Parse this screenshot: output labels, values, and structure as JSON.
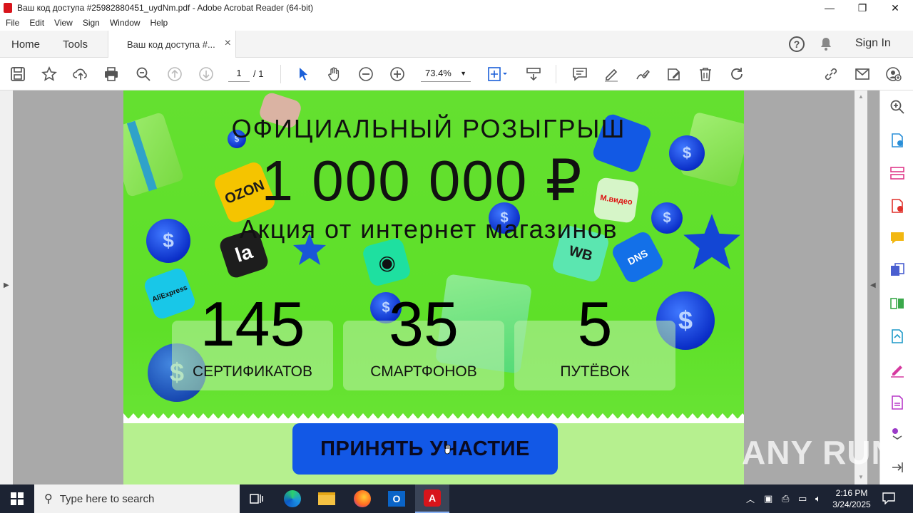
{
  "window": {
    "title": "Ваш код доступа #25982880451_uydNm.pdf - Adobe Acrobat Reader (64-bit)",
    "minimize": "—",
    "maximize": "❐",
    "close": "✕"
  },
  "menu": [
    "File",
    "Edit",
    "View",
    "Sign",
    "Window",
    "Help"
  ],
  "tabs": {
    "home": "Home",
    "tools": "Tools",
    "document": "Ваш код доступа #...",
    "close": "×"
  },
  "account": {
    "sign_in": "Sign In"
  },
  "toolbar": {
    "page_current": "1",
    "page_total": "/ 1",
    "zoom": "73.4%"
  },
  "document": {
    "heading_top": "ОФИЦИАЛЬНЫЙ РОЗЫГРЫШ",
    "amount": "1 000 000 ₽",
    "subheading": "Акция от интернет магазинов",
    "stats": [
      {
        "number": "145",
        "label": "СЕРТИФИКАТОВ"
      },
      {
        "number": "35",
        "label": "СМАРТФОНОВ"
      },
      {
        "number": "5",
        "label": "ПУТЁВОК"
      }
    ],
    "cta": "ПРИНЯТЬ УЧАСТИЕ",
    "logos": {
      "ozon": "OZON",
      "la": "la",
      "wb": "WB",
      "dns": "DNS",
      "mvideo": "М.видео",
      "aliexpress": "AliExpress",
      "coin_symbol": "$"
    },
    "colors": {
      "page_bg": "#5ee028",
      "cta_bg": "#1258e6",
      "coin": "#0b2fc8"
    }
  },
  "watermark": "ANY RUN",
  "taskbar": {
    "search_placeholder": "Type here to search",
    "time": "2:16 PM",
    "date": "3/24/2025"
  }
}
